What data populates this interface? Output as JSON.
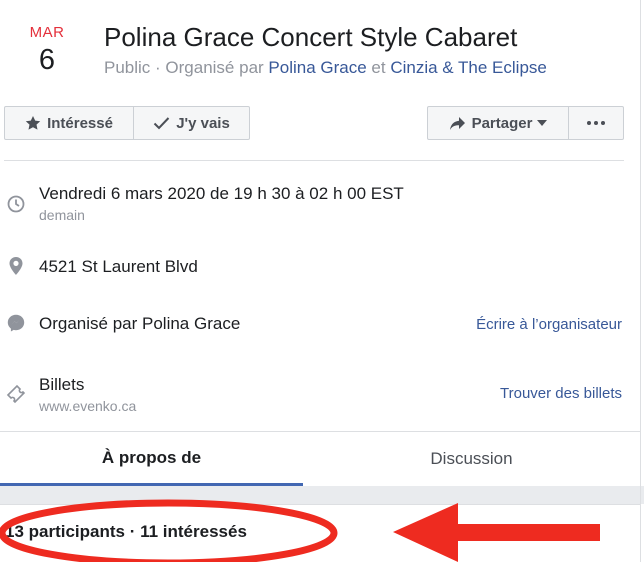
{
  "event": {
    "month": "MAR",
    "day": "6",
    "title": "Polina Grace Concert Style Cabaret",
    "visibility": "Public · Organisé par ",
    "organizer1": "Polina Grace",
    "connector": " et ",
    "organizer2": "Cinzia & The Eclipse"
  },
  "actions": {
    "interested_label": "Intéressé",
    "going_label": "J'y vais",
    "share_label": "Partager"
  },
  "details": {
    "datetime": "Vendredi 6 mars 2020 de 19 h 30 à 02 h 00 EST",
    "datetime_sub": "demain",
    "address": "4521 St Laurent Blvd",
    "organizer_line": "Organisé par Polina Grace",
    "contact_link": "Écrire à l’organisateur",
    "tickets_label": "Billets",
    "tickets_site": "www.evenko.ca",
    "tickets_link": "Trouver des billets"
  },
  "tabs": [
    {
      "label": "À propos de",
      "active": true
    },
    {
      "label": "Discussion",
      "active": false
    }
  ],
  "attendance": {
    "summary": "13 participants · 11 intéressés"
  },
  "colors": {
    "accent_red": "#e4303b",
    "link_blue": "#385898",
    "tab_underline": "#4267b2",
    "annotation_red": "#ee2b20"
  },
  "icons": {
    "interested": "star-icon",
    "going": "check-icon",
    "share": "share-arrow-icon",
    "more": "more-dots-icon",
    "datetime": "clock-icon",
    "address": "location-pin-icon",
    "organizer": "messenger-icon",
    "tickets": "ticket-icon"
  }
}
